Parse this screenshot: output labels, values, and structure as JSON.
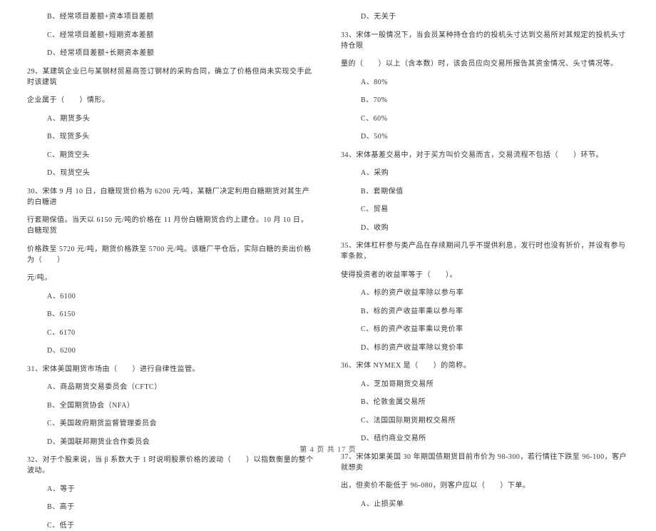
{
  "left": {
    "opt_b": "B、经常项目差额+资本项目差额",
    "opt_c": "C、经常项目差额+短期资本差额",
    "opt_d": "D、经常项目差额+长期资本差额",
    "q29_l1": "29、某建筑企业已与某钢材贸易商签订钢材的采购合同，确立了价格但尚未实现交手此时该建筑",
    "q29_l2": "企业属于（　　）情形。",
    "q29_a": "A、期货多头",
    "q29_b": "B、现货多头",
    "q29_c": "C、期货空头",
    "q29_d": "D、现货空头",
    "q30_l1": "30、宋体 9 月 10 日，白糖现货价格为 6200 元/吨，某糖厂决定利用白糖期货对其生产的白糖进",
    "q30_l2": "行套期保值。当天以 6150 元/吨的价格在 11 月份白糖期货合约上建仓。10 月 10 日，白糖现货",
    "q30_l3": "价格跌至 5720 元/吨，期货价格跌至 5700 元/吨。该糖厂平仓后，实际白糖的卖出价格为（　　）",
    "q30_l4": "元/吨。",
    "q30_a": "A、6100",
    "q30_b": "B、6150",
    "q30_c": "C、6170",
    "q30_d": "D、6200",
    "q31": "31、宋体美国期货市场由（　　）进行自律性监管。",
    "q31_a": "A、商品期货交易委员会（CFTC）",
    "q31_b": "B、全国期货协会（NFA）",
    "q31_c": "C、美国政府期货监督管理委员会",
    "q31_d": "D、美国联邦期货业合作委员会",
    "q32": "32、对于个股来说，当 β 系数大于 1 时说明股票价格的波动（　　）以指数衡量的整个波动。",
    "q32_a": "A、等于",
    "q32_b": "B、高于",
    "q32_c": "C、低于"
  },
  "right": {
    "opt_d_top": "D、无关于",
    "q33_l1": "33、宋体一般情况下，当会员某种持仓合约的投机头寸达到交易所对其规定的投机头寸持仓限",
    "q33_l2": "量的（　　）以上（含本数）时，该会员应向交易所报告其资金情况、头寸情况等。",
    "q33_a": "A、80%",
    "q33_b": "B、70%",
    "q33_c": "C、60%",
    "q33_d": "D、50%",
    "q34": "34、宋体基差交易中，对于买方叫价交易而言，交易流程不包括（　　）环节。",
    "q34_a": "A、采购",
    "q34_b": "B、套期保值",
    "q34_c": "C、贸易",
    "q34_d": "D、收购",
    "q35_l1": "35、宋体杠杆参与类产品在存续期间几乎不提供利息，发行时也没有折价，并设有参与率条款，",
    "q35_l2": "使得投资者的收益率等于（　　）。",
    "q35_a": "A、标的资产收益率除以参与率",
    "q35_b": "B、标的资产收益率乘以参与率",
    "q35_c": "C、标的资产收益率乘以竞价率",
    "q35_d": "D、标的资产收益率除以竞价率",
    "q36": "36、宋体 NYMEX 是（　　）的简称。",
    "q36_a": "A、芝加哥期货交易所",
    "q36_b": "B、伦敦金属交易所",
    "q36_c": "C、法国国际期货期权交易所",
    "q36_d": "D、纽约商业交易所",
    "q37_l1": "37、宋体如果美国 30 年期国债期货目前市价为 98-300，若行情往下跌至 96-100，客户就想卖",
    "q37_l2": "出，但卖价不能低于 96-080，则客户应以（　　）下单。",
    "q37_a": "A、止损买单"
  },
  "footer": "第 4 页 共 17 页"
}
